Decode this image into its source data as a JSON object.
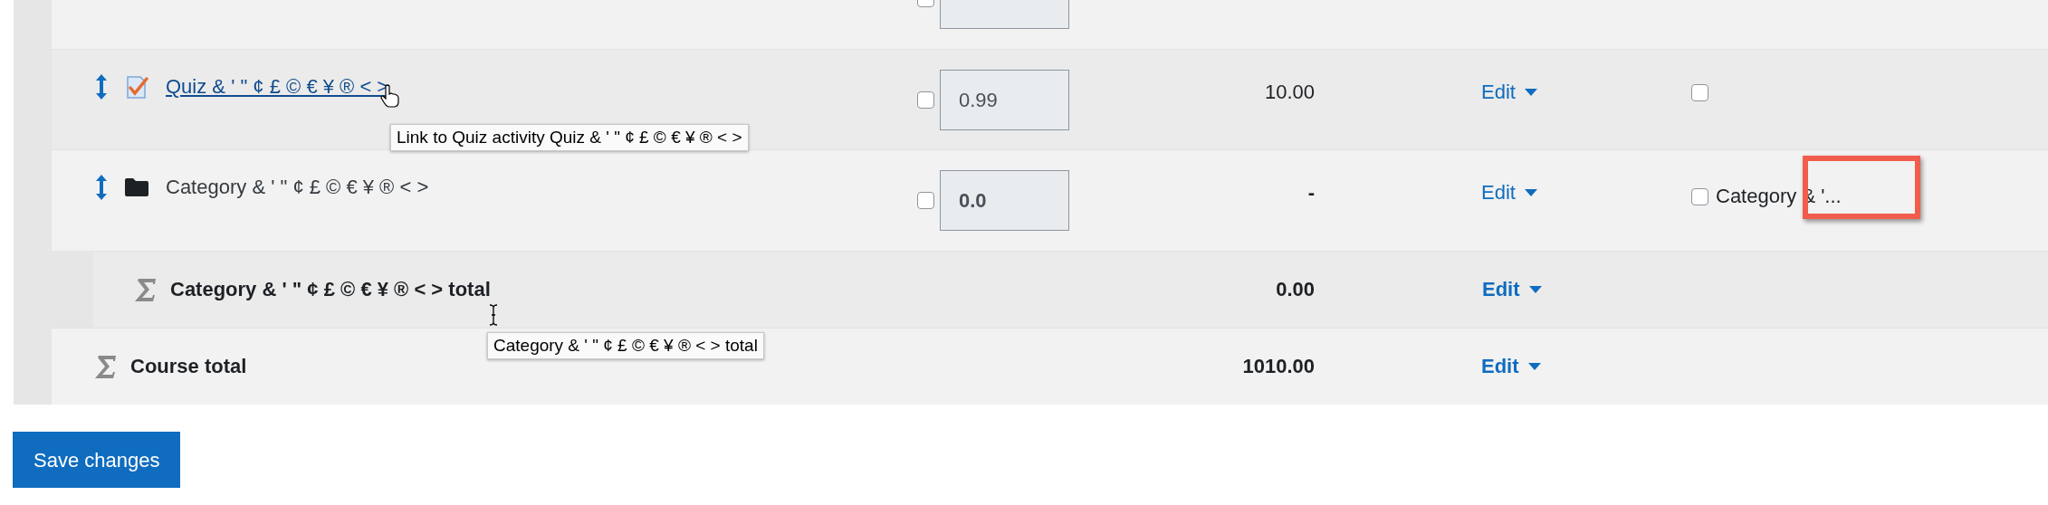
{
  "rows": [
    {
      "kind": "cut_off",
      "weight_checked": false
    },
    {
      "kind": "item",
      "name": "Quiz & ' \" ¢ £ © € ¥ ® < >",
      "weight": "0.99",
      "weight_checked": false,
      "max": "10.00",
      "edit": "Edit",
      "extra_checked": false,
      "tooltip": "Link to Quiz activity Quiz & ' \" ¢ £ © € ¥ ® < >"
    },
    {
      "kind": "category",
      "name": "Category & ' \" ¢ £ © € ¥ ® < >",
      "weight": "0.0",
      "weight_checked": false,
      "max": "-",
      "edit": "Edit",
      "extra_checked": false,
      "extra_label": "Category & '..."
    },
    {
      "kind": "category_total",
      "name": "Category & ' \" ¢ £ © € ¥ ® < > total",
      "max": "0.00",
      "edit": "Edit",
      "tooltip": "Category & ' \" ¢ £ © € ¥ ® < > total"
    },
    {
      "kind": "course_total",
      "name": "Course total",
      "max": "1010.00",
      "edit": "Edit"
    }
  ],
  "save_button": "Save changes"
}
